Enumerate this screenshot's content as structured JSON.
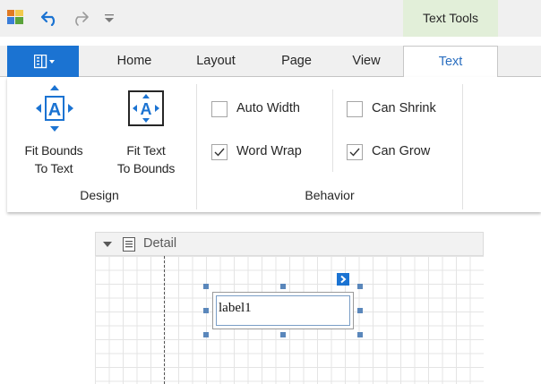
{
  "qat": {
    "app_icon": "report-designer-icon",
    "undo_icon": "undo-icon",
    "redo_icon": "redo-icon",
    "customize_icon": "qat-customize-icon"
  },
  "context_group": {
    "label": "Text Tools",
    "color": "#e2efd9"
  },
  "file_button": {
    "icon": "ribbon-menu-icon",
    "color": "#1b73d2"
  },
  "tabs": [
    {
      "label": "Home"
    },
    {
      "label": "Layout"
    },
    {
      "label": "Page"
    },
    {
      "label": "View"
    },
    {
      "label": "Text",
      "active": true
    }
  ],
  "ribbon": {
    "design": {
      "caption": "Design",
      "fit_bounds": {
        "label": "Fit Bounds\nTo Text",
        "icon": "fit-bounds-to-text-icon"
      },
      "fit_text": {
        "label": "Fit Text\nTo Bounds",
        "icon": "fit-text-to-bounds-icon"
      }
    },
    "behavior": {
      "caption": "Behavior",
      "auto_width": {
        "label": "Auto Width",
        "checked": false
      },
      "word_wrap": {
        "label": "Word Wrap",
        "checked": true
      },
      "can_shrink": {
        "label": "Can Shrink",
        "checked": false
      },
      "can_grow": {
        "label": "Can Grow",
        "checked": true
      }
    }
  },
  "designer": {
    "band": {
      "title": "Detail",
      "expand_icon": "collapse-triangle-icon",
      "band_icon": "band-icon"
    },
    "label_control": {
      "text": "label1",
      "smart_tag_icon": "smart-tag-icon"
    }
  },
  "accent": "#1b73d2"
}
